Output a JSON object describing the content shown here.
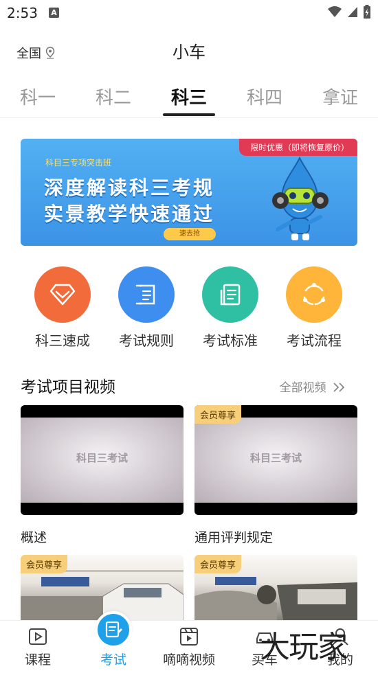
{
  "status_bar": {
    "time": "2:53",
    "notif_glyph": "A"
  },
  "header": {
    "location": "全国",
    "title": "小车"
  },
  "tabs": [
    {
      "label": "科一"
    },
    {
      "label": "科二"
    },
    {
      "label": "科三",
      "active": true
    },
    {
      "label": "科四"
    },
    {
      "label": "拿证"
    }
  ],
  "banner": {
    "tag": "限时优惠（即将恢复原价）",
    "subtitle": "科目三专项突击班",
    "line1": "深度解读科三考规",
    "line2": "实景教学快速通过",
    "cta": "速去抢"
  },
  "quick_links": [
    {
      "label": "科三速成",
      "color": "#f26b3a",
      "icon": "diamond-icon"
    },
    {
      "label": "考试规则",
      "color": "#3e8ef0",
      "icon": "scroll-icon"
    },
    {
      "label": "考试标准",
      "color": "#2fc0a4",
      "icon": "document-icon"
    },
    {
      "label": "考试流程",
      "color": "#ffb43a",
      "icon": "cycle-icon"
    }
  ],
  "video_section": {
    "title": "考试项目视频",
    "more": "全部视频"
  },
  "videos": [
    {
      "caption": "概述",
      "watermark": "科目三考试",
      "badge": ""
    },
    {
      "caption": "通用评判规定",
      "watermark": "科目三考试",
      "badge": "会员尊享"
    },
    {
      "caption": "",
      "watermark": "",
      "badge": "会员尊享"
    },
    {
      "caption": "",
      "watermark": "",
      "badge": "会员尊享"
    }
  ],
  "bottom_nav": [
    {
      "label": "课程",
      "icon": "course-icon"
    },
    {
      "label": "考试",
      "icon": "exam-icon",
      "active": true
    },
    {
      "label": "嘀嘀视频",
      "icon": "video-icon"
    },
    {
      "label": "买车",
      "icon": "car-icon"
    },
    {
      "label": "我的",
      "icon": "profile-icon"
    }
  ],
  "watermark": "大玩家"
}
